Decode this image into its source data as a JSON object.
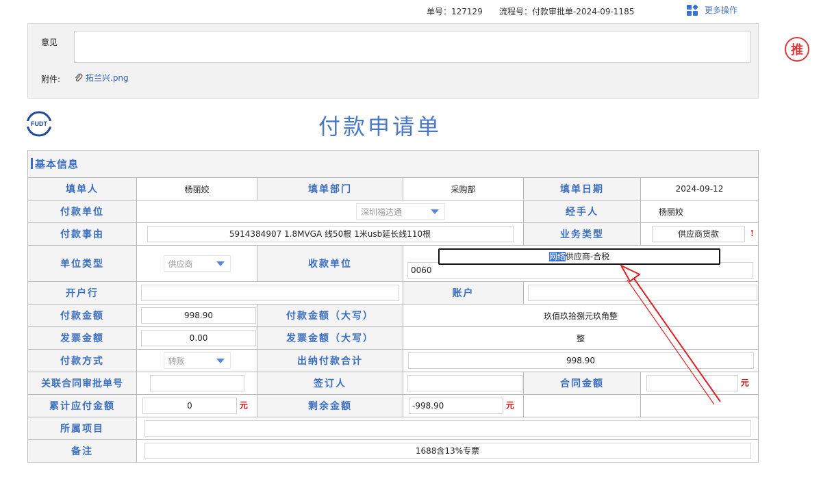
{
  "header": {
    "order_no": "单号：127129",
    "process_no": "流程号：付款审批单-2024-09-1185",
    "more_ops": "更多操作"
  },
  "seal_text": "推",
  "opinion": {
    "label": "意见",
    "value": "",
    "attach_label": "附件:",
    "attachment": "拓兰兴.png"
  },
  "logo_text": "FUDT",
  "form": {
    "title": "付款申请单",
    "section": "基本信息",
    "labels": {
      "filler": "填单人",
      "dept": "填单部门",
      "date": "填单日期",
      "payee_unit": "付款单位",
      "handler": "经手人",
      "reason": "付款事由",
      "biz_type": "业务类型",
      "unit_type": "单位类型",
      "receiver": "收款单位",
      "bank": "开户行",
      "account": "账户",
      "amount": "付款金额",
      "amount_cn": "付款金额（大写）",
      "invoice": "发票金额",
      "invoice_cn": "发票金额（大写）",
      "method": "付款方式",
      "cashier_total": "出纳付款合计",
      "contract_no": "关联合同审批单号",
      "signer": "签订人",
      "contract_amt": "合同金额",
      "accum": "累计应付金额",
      "remain": "剩余金额",
      "project": "所属项目",
      "remark": "备注"
    },
    "values": {
      "filler": "杨丽姣",
      "dept": "采购部",
      "date": "2024-09-12",
      "payee_unit": "深圳福达通",
      "handler": "杨丽姣",
      "reason": "5914384907 1.8MVGA 线50根 1米usb延长线110根",
      "biz_type": "供应商货款",
      "required_mark": "!",
      "unit_type": "供应商",
      "receiver_highlight": "网络",
      "receiver_rest": "供应商-合税",
      "receiver_input": "0060",
      "bank": "",
      "account": "",
      "amount": "998.90",
      "amount_cn": "玖佰玖拾捌元玖角整",
      "invoice": "0.00",
      "invoice_cn": "整",
      "method": "转账",
      "cashier_total": "998.90",
      "contract_no": "",
      "signer": "",
      "contract_amt": "",
      "unit": "元",
      "accum": "0",
      "remain": "-998.90",
      "project": "",
      "remark": "1688含13%专票"
    }
  },
  "colors": {
    "accent": "#3d6fbf",
    "highlight": "#3a70d6",
    "annotation": "#e02020",
    "seal": "#d93a3a"
  }
}
